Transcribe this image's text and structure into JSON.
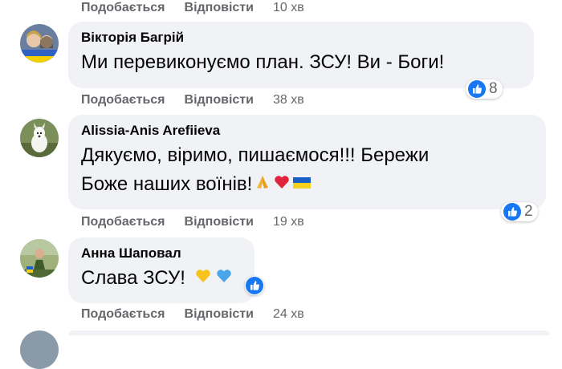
{
  "labels": {
    "like": "Подобається",
    "reply": "Відповісти"
  },
  "top_actions": {
    "time": "10 хв"
  },
  "comments": [
    {
      "author": "Вікторія Багрій",
      "text": "Ми перевиконуємо план. ЗСУ! Ви - Боги!",
      "reactions_count": "8",
      "time": "38 хв"
    },
    {
      "author": "Alissia-Anis Arefiieva",
      "text_line1": "Дякуємо, віримо, пишаємося!!! Бережи",
      "text_line2": "Боже наших воїнів!",
      "reactions_count": "2",
      "time": "19 хв"
    },
    {
      "author": "Анна Шаповал",
      "text": "Слава ЗСУ!",
      "time": "24 хв"
    }
  ],
  "colors": {
    "bubble": "#f0f2f5",
    "secondary_text": "#65676b",
    "like_blue": "#1877f2"
  },
  "icons": [
    "like-icon",
    "folded-hands-emoji",
    "red-heart-emoji",
    "ukraine-flag-emoji",
    "yellow-heart-emoji",
    "blue-heart-emoji"
  ]
}
